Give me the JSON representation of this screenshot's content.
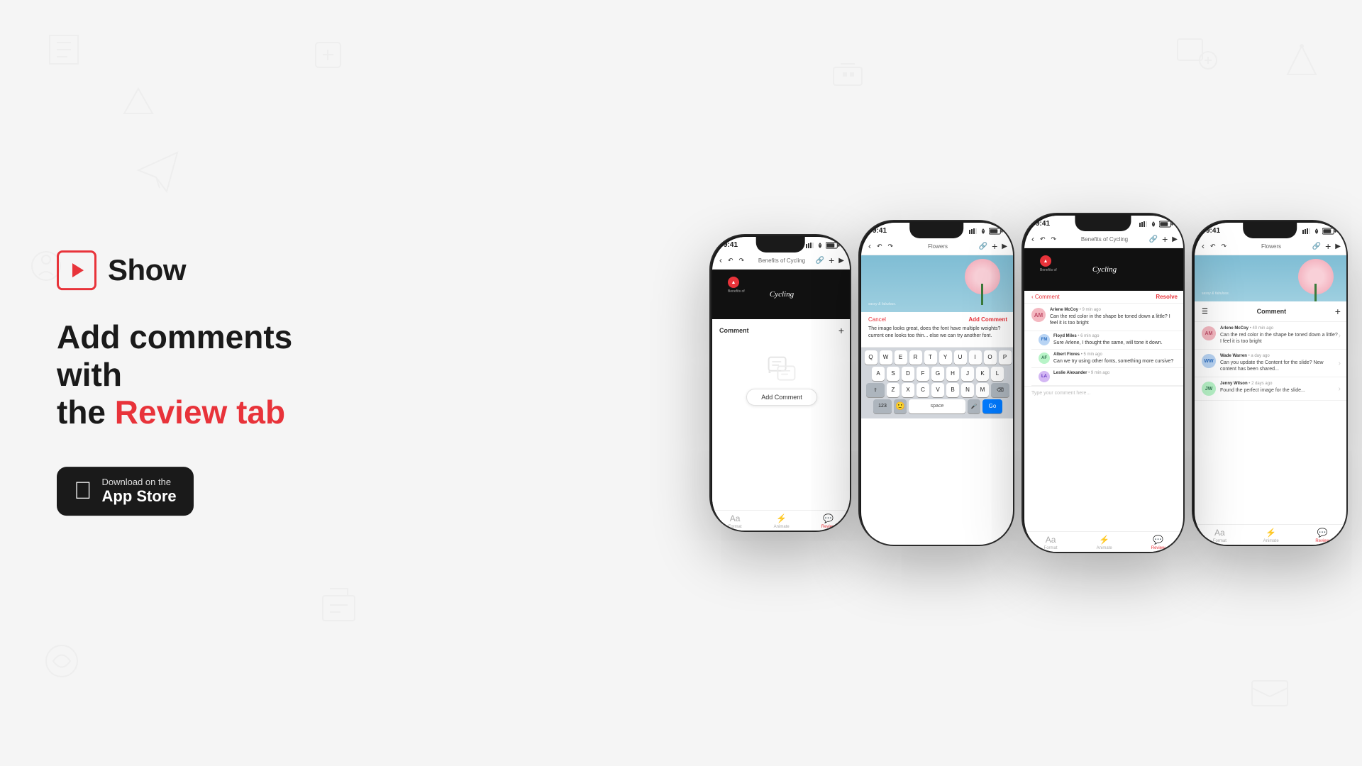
{
  "page": {
    "background": "#f5f5f5"
  },
  "brand": {
    "name": "Show",
    "logo_label": "Show app logo"
  },
  "headline": {
    "line1": "Add comments with",
    "line2": "the ",
    "highlight": "Review tab"
  },
  "app_store": {
    "download_label": "Download on the",
    "store_label": "App Store"
  },
  "phones": {
    "phone1": {
      "status_time": "9:41",
      "title": "Benefits of Cycling",
      "comment_title": "Comment",
      "add_comment_btn": "Add Comment",
      "tabs": [
        "Format",
        "Animate",
        "Review"
      ]
    },
    "phone2": {
      "status_time": "9:41",
      "title": "Flowers",
      "cancel": "Cancel",
      "add_comment": "Add Comment",
      "comment_placeholder": "The image looks great, does the font have multiple weights? current one looks too thin... else we can try another font.",
      "keyboard_rows": [
        [
          "Q",
          "W",
          "E",
          "R",
          "T",
          "Y",
          "U",
          "I",
          "O",
          "P"
        ],
        [
          "A",
          "S",
          "D",
          "F",
          "G",
          "H",
          "J",
          "K",
          "L"
        ],
        [
          "⇧",
          "Z",
          "X",
          "C",
          "V",
          "B",
          "N",
          "M",
          "⌫"
        ],
        [
          "123",
          "space",
          "Go"
        ]
      ]
    },
    "phone3": {
      "status_time": "9:41",
      "title": "Benefits of Cycling",
      "back_label": "Comment",
      "resolve_label": "Resolve",
      "comments": [
        {
          "author": "Arlene McCoy",
          "time": "9 min ago",
          "text": "Can the red color in the shape be toned down a little? I feel it is too bright",
          "avatar_initials": "AM"
        }
      ],
      "replies": [
        {
          "author": "Floyd Miles",
          "time": "6 min ago",
          "text": "Sure Arlene, I thought the same, will tone it down.",
          "avatar_initials": "FM"
        },
        {
          "author": "Albert Flores",
          "time": "5 min ago",
          "text": "Can we try using other fonts, something more cursive?",
          "avatar_initials": "AF"
        },
        {
          "author": "Leslie Alexander",
          "time": "9 min ago",
          "text": "",
          "avatar_initials": "LA"
        }
      ],
      "type_placeholder": "Type your comment here...",
      "tabs": [
        "Format",
        "Animate",
        "Review"
      ]
    },
    "phone4": {
      "status_time": "9:41",
      "title": "Flowers",
      "comment_title": "Comment",
      "comments": [
        {
          "author": "Arlene McCoy",
          "time": "40 min ago",
          "text": "Can the red color in the shape be toned down a little? I feel it is too bright",
          "avatar_initials": "AM"
        },
        {
          "author": "Wade Warren",
          "time": "a day ago",
          "text": "Can you update the Content for the slide? New content has been shared...",
          "avatar_initials": "WW"
        },
        {
          "author": "Jenny Wilson",
          "time": "2 days ago",
          "text": "Found the perfect image for the slide...",
          "avatar_initials": "JW"
        }
      ],
      "tabs": [
        "Format",
        "Animate",
        "Review"
      ]
    }
  }
}
